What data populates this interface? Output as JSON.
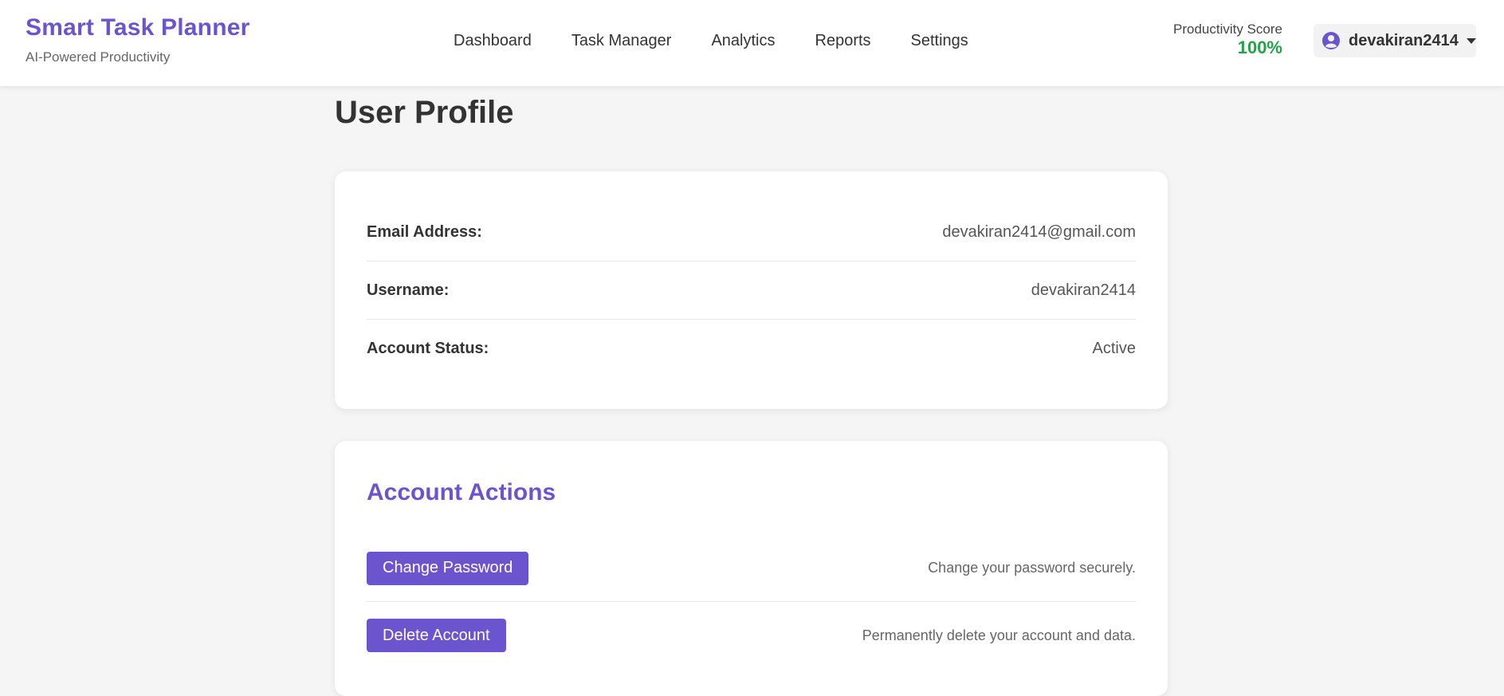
{
  "header": {
    "brand_title": "Smart Task Planner",
    "brand_subtitle": "AI-Powered Productivity",
    "nav": [
      {
        "label": "Dashboard"
      },
      {
        "label": "Task Manager"
      },
      {
        "label": "Analytics"
      },
      {
        "label": "Reports"
      },
      {
        "label": "Settings"
      }
    ],
    "score_label": "Productivity Score",
    "score_value": "100%",
    "username": "devakiran2414",
    "user_icon": "user-circle-icon",
    "caret_icon": "caret-down-icon"
  },
  "page": {
    "title": "User Profile"
  },
  "profile": {
    "email_label": "Email Address:",
    "email_value": "devakiran2414@gmail.com",
    "username_label": "Username:",
    "username_value": "devakiran2414",
    "status_label": "Account Status:",
    "status_value": "Active"
  },
  "actions": {
    "title": "Account Actions",
    "change_password_label": "Change Password",
    "change_password_desc": "Change your password securely.",
    "delete_account_label": "Delete Account",
    "delete_account_desc": "Permanently delete your account and data."
  },
  "colors": {
    "accent": "#6a55cf",
    "score": "#22a34a",
    "background": "#f5f5f5"
  }
}
